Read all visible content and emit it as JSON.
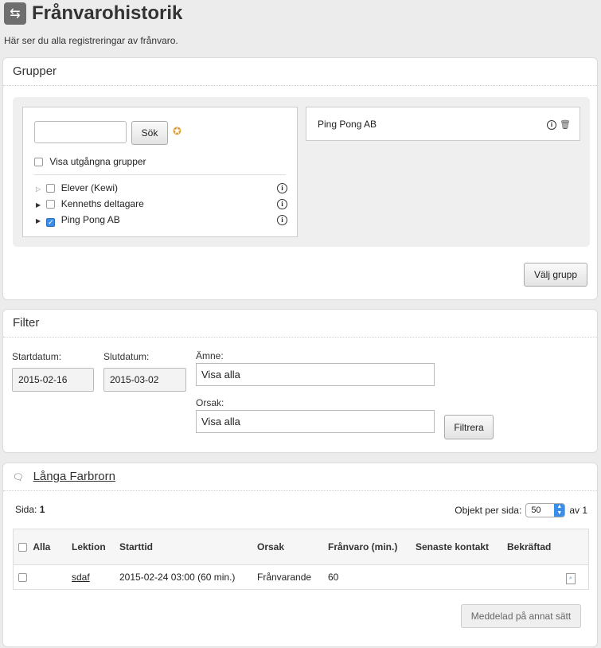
{
  "page": {
    "title": "Frånvarohistorik",
    "description": "Här ser du alla registreringar av frånvaro."
  },
  "groups": {
    "title": "Grupper",
    "search": {
      "placeholder": "",
      "button": "Sök"
    },
    "show_expired_label": "Visa utgångna grupper",
    "items": [
      {
        "label": "Elever (Kewi)",
        "checked": false
      },
      {
        "label": "Kenneths deltagare",
        "checked": false
      },
      {
        "label": "Ping Pong AB",
        "checked": true
      }
    ],
    "selected": [
      "Ping Pong AB"
    ],
    "choose_button": "Välj grupp"
  },
  "filter": {
    "title": "Filter",
    "start_label": "Startdatum:",
    "start_value": "2015-02-16",
    "end_label": "Slutdatum:",
    "end_value": "2015-03-02",
    "subject_label": "Ämne:",
    "subject_value": "Visa alla",
    "reason_label": "Orsak:",
    "reason_value": "Visa alla",
    "filter_button": "Filtrera"
  },
  "results": {
    "student": "Långa Farbrorn",
    "page_label": "Sida:",
    "page_number": "1",
    "per_page_label": "Objekt per sida:",
    "per_page_value": "50",
    "of_label": "av 1",
    "columns": [
      "Alla",
      "Lektion",
      "Starttid",
      "Orsak",
      "Frånvaro (min.)",
      "Senaste kontakt",
      "Bekräftad"
    ],
    "rows": [
      {
        "lesson": "sdaf",
        "start": "2015-02-24 03:00 (60 min.)",
        "reason": "Frånvarande",
        "absence": "60",
        "last_contact": "",
        "confirmed": ""
      }
    ],
    "notified_button": "Meddelad på annat sätt"
  }
}
